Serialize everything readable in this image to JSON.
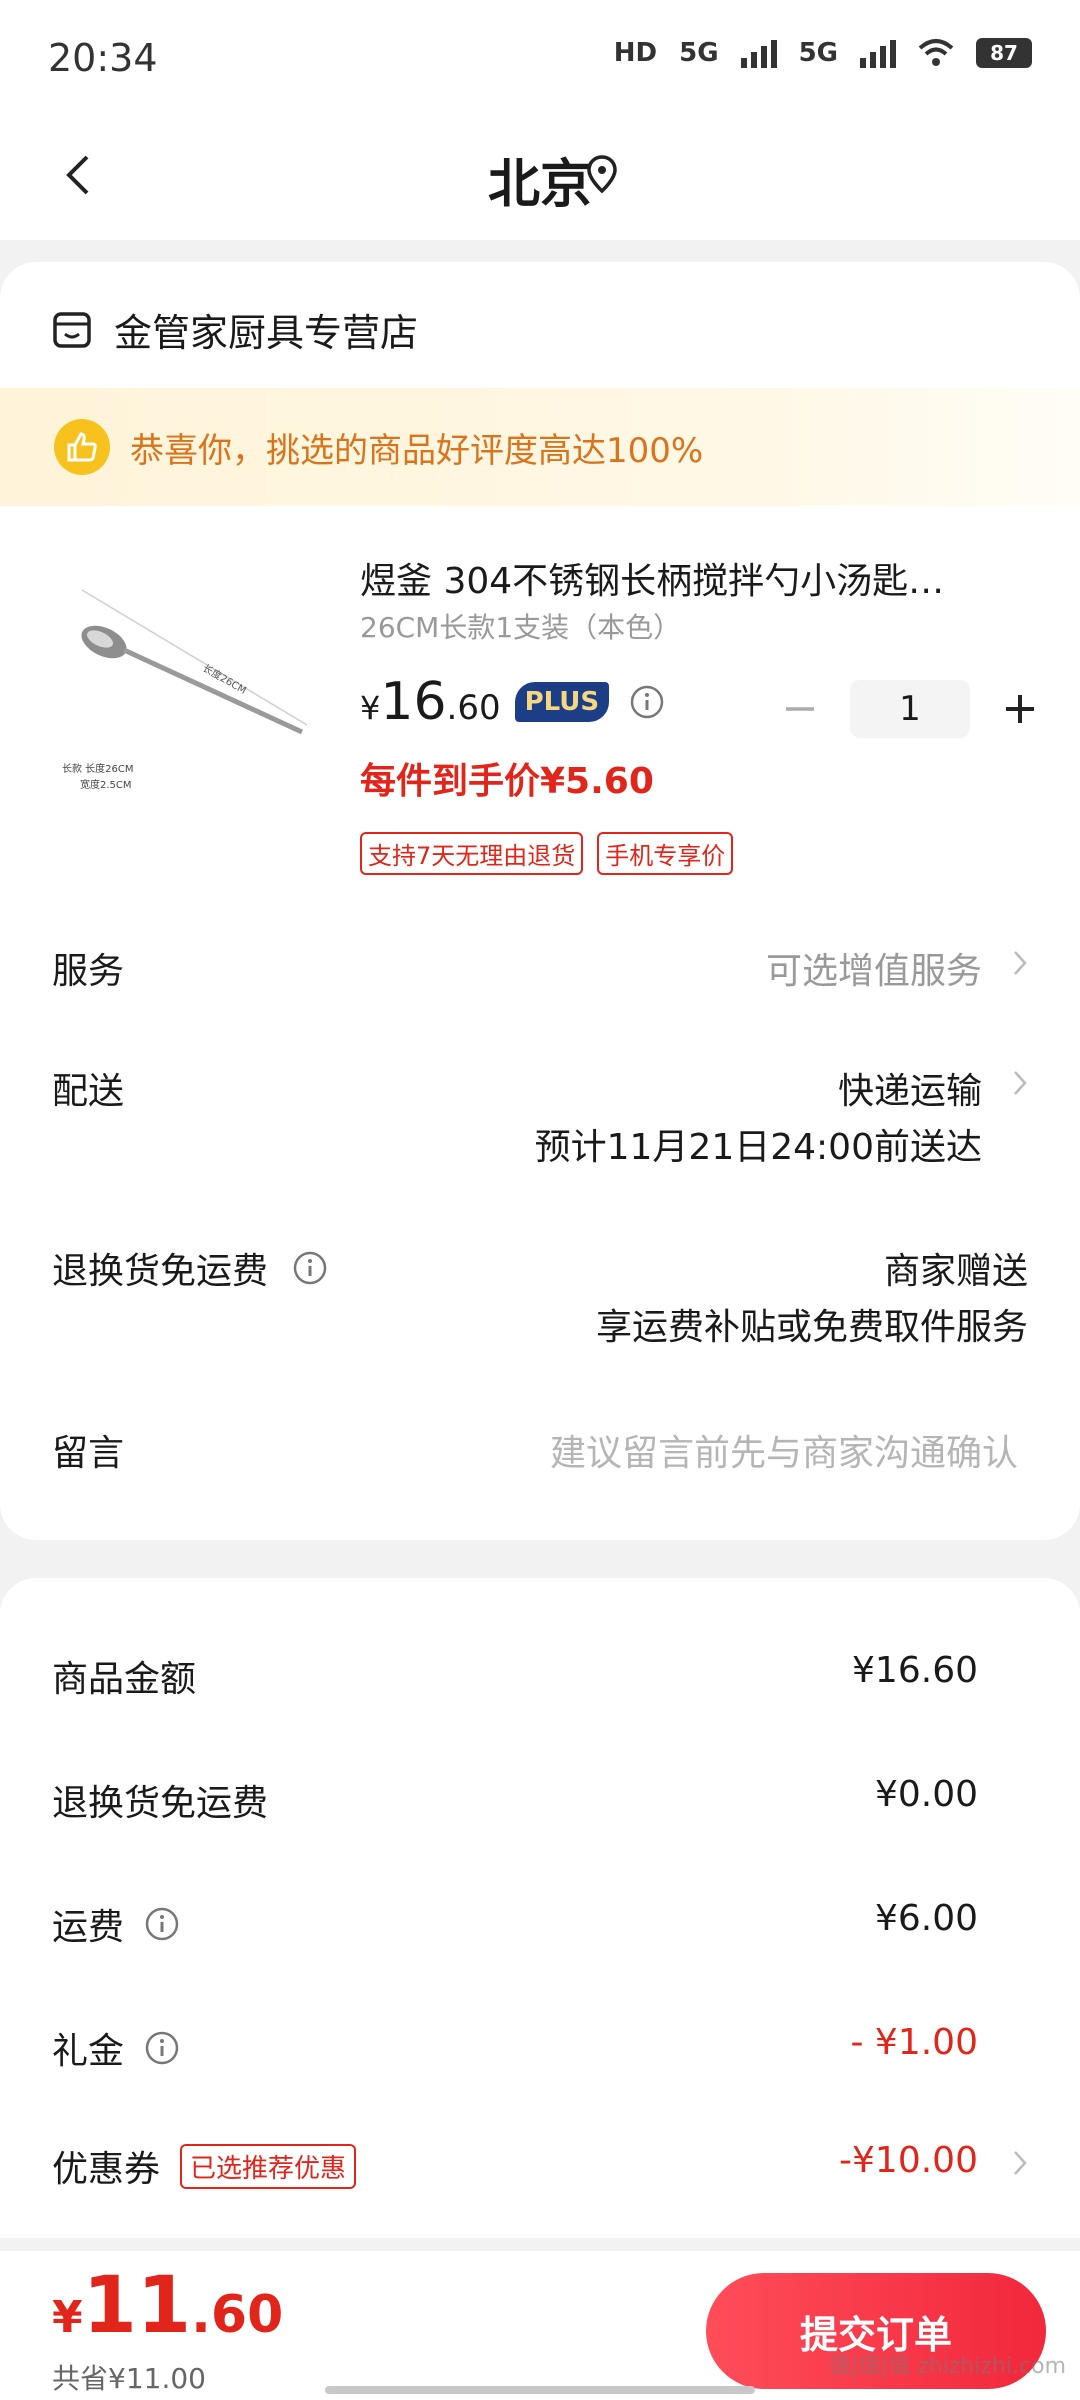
{
  "status_bar": {
    "time": "20:34",
    "battery": "87",
    "network1": "5G",
    "network2": "5G",
    "hd": "HD"
  },
  "header": {
    "title": "北京"
  },
  "store": {
    "name": "金管家厨具专营店"
  },
  "banner": {
    "text": "恭喜你，挑选的商品好评度高达100%"
  },
  "product": {
    "name": "煜釜 304不锈钢长柄搅拌勺小汤匙…",
    "spec": "26CM长款1支装（本色）",
    "price_currency": "¥",
    "price_int": "16",
    "price_dec": ".60",
    "plus_label": "PLUS",
    "quantity": "1",
    "unit_price": "每件到手价¥5.60",
    "tags": [
      "支持7天无理由退货",
      "手机专享价"
    ],
    "image_caption1": "长款 长度26CM",
    "image_caption2": "宽度2.5CM"
  },
  "service": {
    "label": "服务",
    "value": "可选增值服务"
  },
  "delivery": {
    "label": "配送",
    "value": "快递运输",
    "eta": "预计11月21日24:00前送达"
  },
  "return_shipping": {
    "label": "退换货免运费",
    "value": "商家赠送",
    "sub": "享运费补贴或免费取件服务"
  },
  "message": {
    "label": "留言",
    "placeholder": "建议留言前先与商家沟通确认"
  },
  "summary": {
    "goods_label": "商品金额",
    "goods_value": "¥16.60",
    "return_label": "退换货免运费",
    "return_value": "¥0.00",
    "freight_label": "运费",
    "freight_value": "¥6.00",
    "gift_label": "礼金",
    "gift_value": "- ¥1.00",
    "coupon_label": "优惠券",
    "coupon_tag": "已选推荐优惠",
    "coupon_value": "-¥10.00"
  },
  "bottom": {
    "currency": "¥",
    "total_int": "11",
    "total_dec": ".60",
    "saved": "共省¥11.00",
    "submit": "提交订单",
    "watermark": "值|值|值 zhizhizhi.com"
  },
  "colors": {
    "accent": "#e1251b",
    "submit": "#f2273c",
    "plus_bg": "#1b3e86"
  }
}
